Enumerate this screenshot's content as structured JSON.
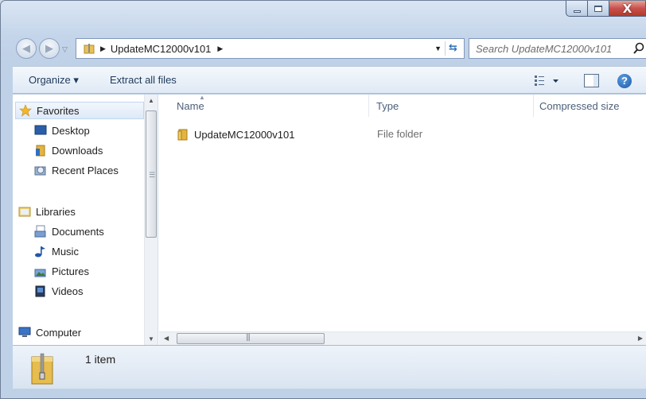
{
  "window": {
    "caption_close": "X"
  },
  "address": {
    "path_segment": "UpdateMC12000v101"
  },
  "search": {
    "placeholder": "Search UpdateMC12000v101"
  },
  "toolbar": {
    "organize_label": "Organize ▾",
    "extract_label": "Extract all files"
  },
  "navigation": {
    "favorites": {
      "label": "Favorites",
      "items": [
        {
          "label": "Desktop",
          "icon": "desktop-icon"
        },
        {
          "label": "Downloads",
          "icon": "downloads-folder-icon"
        },
        {
          "label": "Recent Places",
          "icon": "recent-places-icon"
        }
      ]
    },
    "libraries": {
      "label": "Libraries",
      "items": [
        {
          "label": "Documents",
          "icon": "documents-icon"
        },
        {
          "label": "Music",
          "icon": "music-icon"
        },
        {
          "label": "Pictures",
          "icon": "pictures-icon"
        },
        {
          "label": "Videos",
          "icon": "videos-icon"
        }
      ]
    },
    "computer": {
      "label": "Computer"
    }
  },
  "columns": [
    "Name",
    "Type",
    "Compressed size"
  ],
  "files": [
    {
      "name": "UpdateMC12000v101",
      "type": "File folder",
      "icon": "folder-icon"
    }
  ],
  "status": {
    "item_count": "1 item"
  },
  "colors": {
    "accent": "#1e395b",
    "selection": "#dde9f8",
    "close_button": "#c75050"
  }
}
